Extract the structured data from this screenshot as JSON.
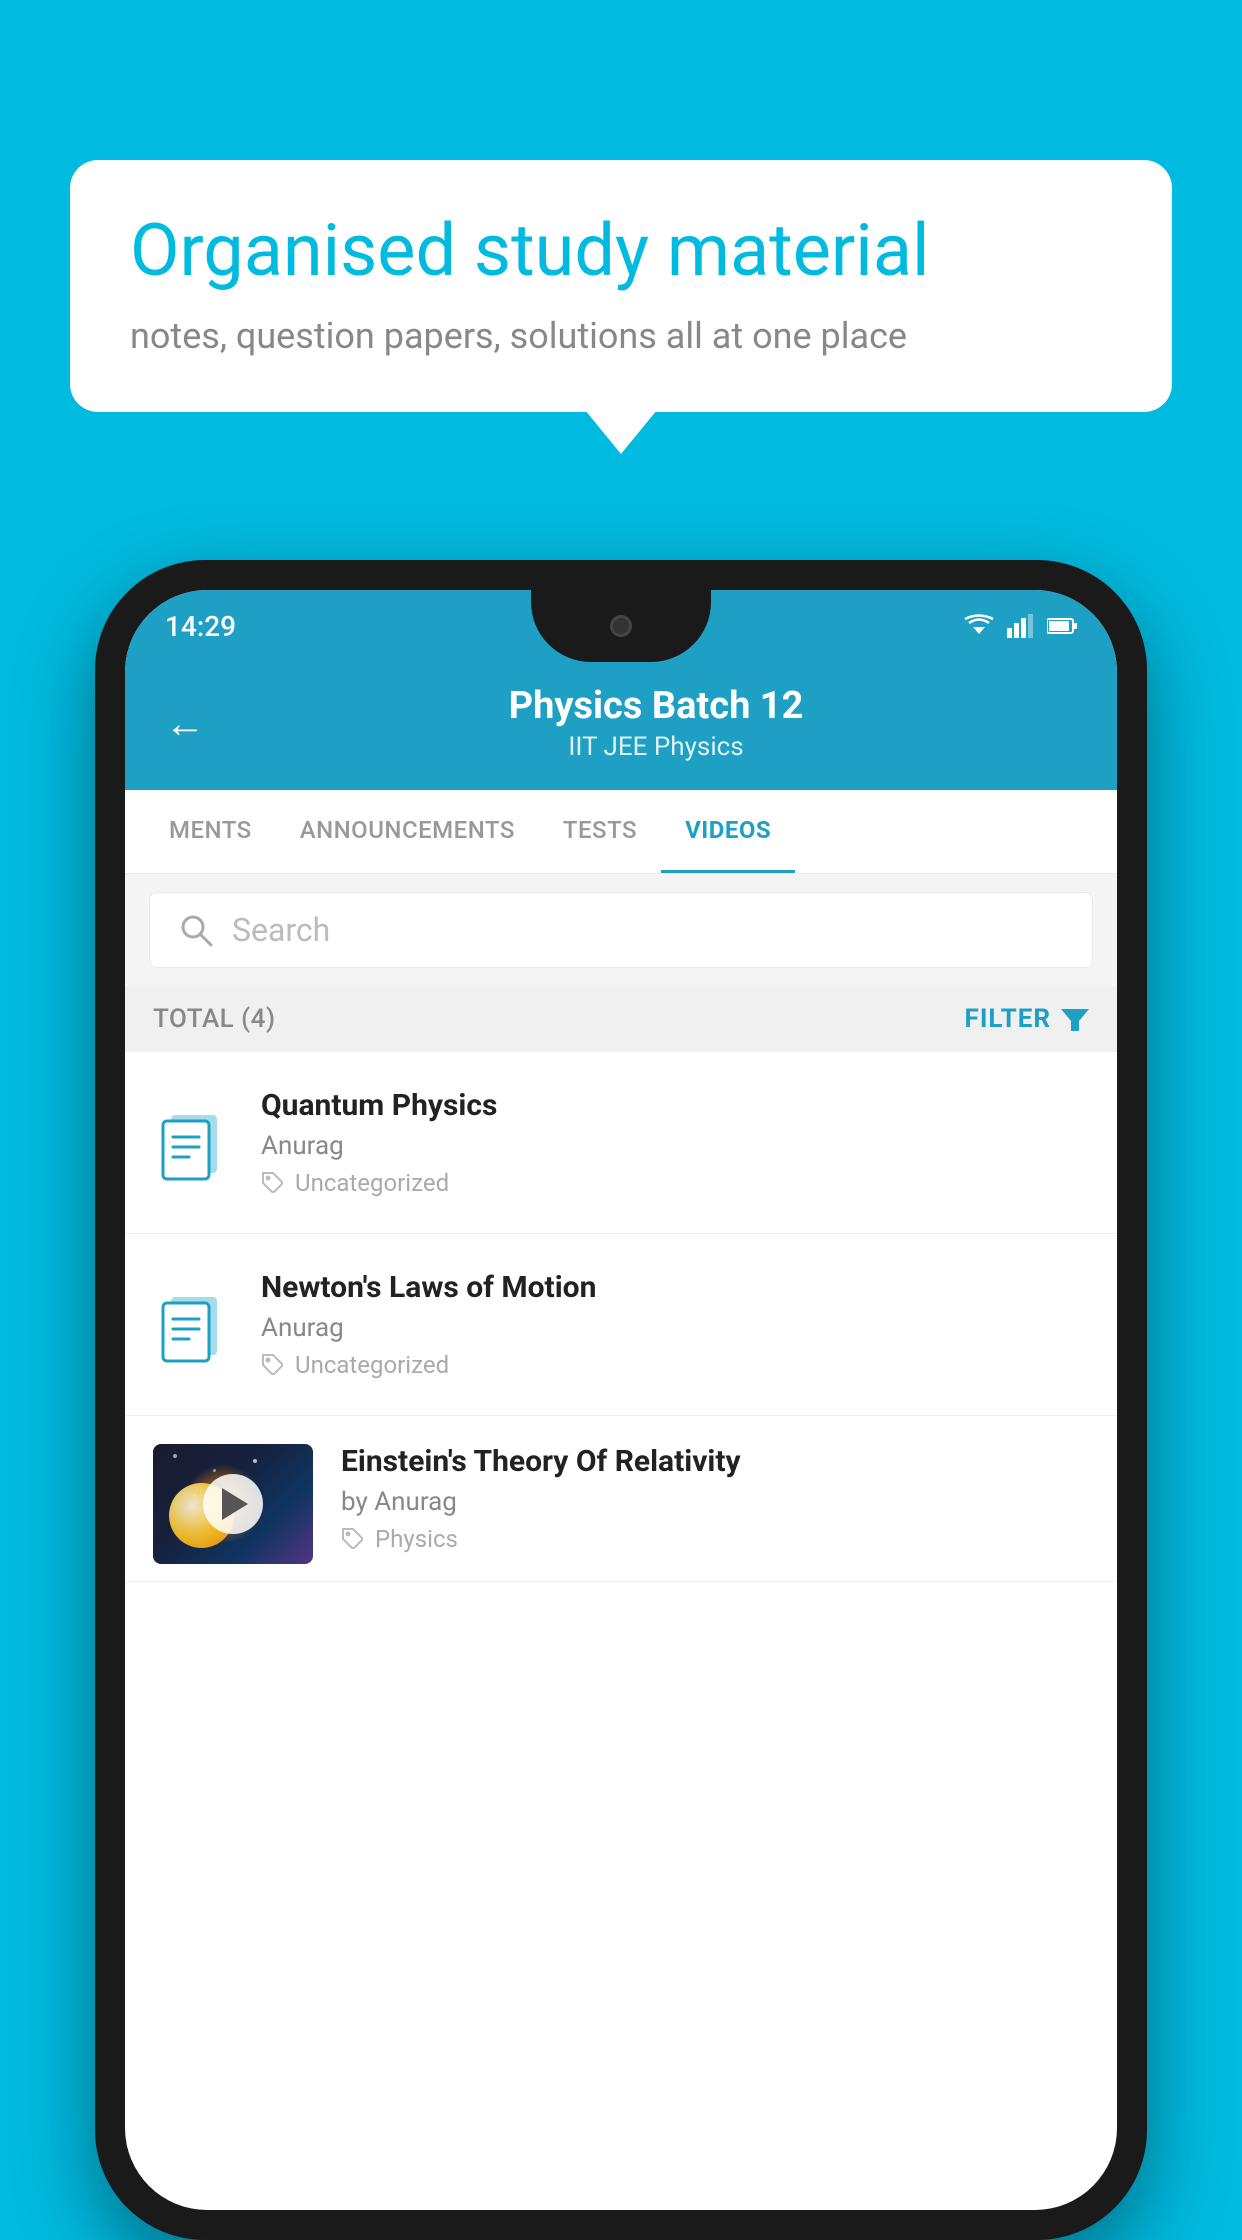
{
  "background_color": "#00BADF",
  "speech_bubble": {
    "title": "Organised study material",
    "subtitle": "notes, question papers, solutions all at one place"
  },
  "phone": {
    "status_bar": {
      "time": "14:29"
    },
    "header": {
      "title": "Physics Batch 12",
      "subtitle": "IIT JEE   Physics",
      "back_label": "←"
    },
    "tabs": [
      {
        "label": "MENTS",
        "active": false
      },
      {
        "label": "ANNOUNCEMENTS",
        "active": false
      },
      {
        "label": "TESTS",
        "active": false
      },
      {
        "label": "VIDEOS",
        "active": true
      }
    ],
    "search": {
      "placeholder": "Search"
    },
    "filter_bar": {
      "total_label": "TOTAL (4)",
      "filter_label": "FILTER"
    },
    "videos": [
      {
        "id": 1,
        "title": "Quantum Physics",
        "author": "Anurag",
        "tag": "Uncategorized",
        "has_thumbnail": false
      },
      {
        "id": 2,
        "title": "Newton's Laws of Motion",
        "author": "Anurag",
        "tag": "Uncategorized",
        "has_thumbnail": false
      },
      {
        "id": 3,
        "title": "Einstein's Theory Of Relativity",
        "author": "by Anurag",
        "tag": "Physics",
        "has_thumbnail": true
      }
    ]
  }
}
